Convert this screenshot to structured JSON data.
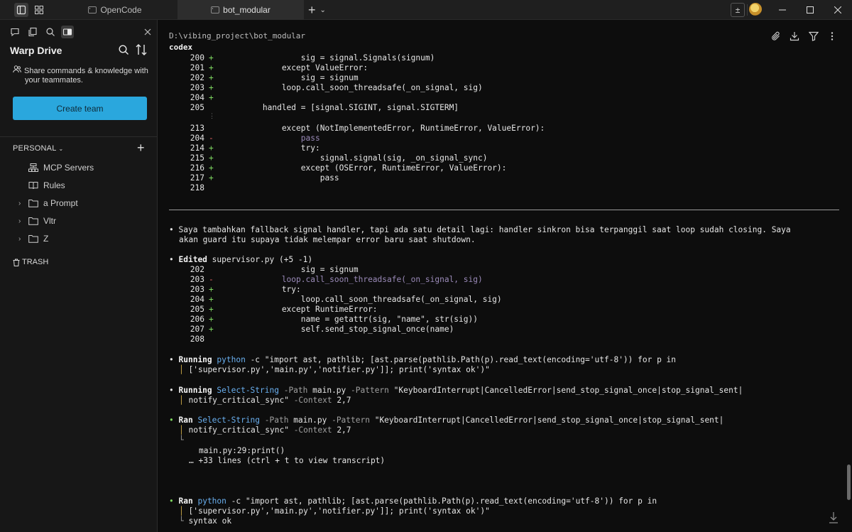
{
  "titlebar": {
    "tabs": [
      {
        "label": "OpenCode",
        "active": false
      },
      {
        "label": "bot_modular",
        "active": true
      }
    ],
    "new_tab_label": "+",
    "share_label": "±"
  },
  "sidebar": {
    "title": "Warp Drive",
    "share_line1": "Share commands & knowledge with",
    "share_line2": "your teammates.",
    "create_team_label": "Create team",
    "personal_label": "PERSONAL",
    "items": [
      {
        "label": "MCP Servers",
        "icon": "mcp-servers-icon",
        "folder": false
      },
      {
        "label": "Rules",
        "icon": "book-icon",
        "folder": false
      },
      {
        "label": "a Prompt",
        "icon": "folder-icon",
        "folder": true
      },
      {
        "label": "Vltr",
        "icon": "folder-icon",
        "folder": true
      },
      {
        "label": "Z",
        "icon": "folder-icon",
        "folder": true
      }
    ],
    "trash_label": "TRASH"
  },
  "main": {
    "path": "D:\\vibing_project\\bot_modular",
    "session": "codex",
    "diff1": [
      {
        "num": "200",
        "mk": "+",
        "code": "                sig = signal.Signals(signum)"
      },
      {
        "num": "201",
        "mk": "+",
        "code": "            except ValueError:"
      },
      {
        "num": "202",
        "mk": "+",
        "code": "                sig = signum"
      },
      {
        "num": "203",
        "mk": "+",
        "code": "            loop.call_soon_threadsafe(_on_signal, sig)"
      },
      {
        "num": "204",
        "mk": "+",
        "code": ""
      },
      {
        "num": "205",
        "mk": "",
        "code": "        handled = [signal.SIGINT, signal.SIGTERM]"
      },
      {
        "num": "213",
        "mk": "",
        "code": "            except (NotImplementedError, RuntimeError, ValueError):"
      },
      {
        "num": "204",
        "mk": "-",
        "code": "                pass"
      },
      {
        "num": "214",
        "mk": "+",
        "code": "                try:"
      },
      {
        "num": "215",
        "mk": "+",
        "code": "                    signal.signal(sig, _on_signal_sync)"
      },
      {
        "num": "216",
        "mk": "+",
        "code": "                except (OSError, RuntimeError, ValueError):"
      },
      {
        "num": "217",
        "mk": "+",
        "code": "                    pass"
      },
      {
        "num": "218",
        "mk": "",
        "code": ""
      }
    ],
    "message_line1": "Saya tambahkan fallback signal handler, tapi ada satu detail lagi: handler sinkron bisa terpanggil saat loop sudah closing. Saya",
    "message_line2": "akan guard itu supaya tidak melempar error baru saat shutdown.",
    "edited_label": "Edited",
    "edited_file": "supervisor.py",
    "edited_stats": "(+5 -1)",
    "diff2": [
      {
        "num": "202",
        "mk": "",
        "code": "                sig = signum"
      },
      {
        "num": "203",
        "mk": "-",
        "code": "            loop.call_soon_threadsafe(_on_signal, sig)"
      },
      {
        "num": "203",
        "mk": "+",
        "code": "            try:"
      },
      {
        "num": "204",
        "mk": "+",
        "code": "                loop.call_soon_threadsafe(_on_signal, sig)"
      },
      {
        "num": "205",
        "mk": "+",
        "code": "            except RuntimeError:"
      },
      {
        "num": "206",
        "mk": "+",
        "code": "                name = getattr(sig, \"name\", str(sig))"
      },
      {
        "num": "207",
        "mk": "+",
        "code": "                self.send_stop_signal_once(name)"
      },
      {
        "num": "208",
        "mk": "",
        "code": ""
      }
    ],
    "run1": {
      "label": "Running",
      "cmd": "python",
      "args": " -c \"import ast, pathlib; [ast.parse(pathlib.Path(p).read_text(encoding='utf-8')) for p in",
      "cont": "['supervisor.py','main.py','notifier.py']]; print('syntax ok')\""
    },
    "run2": {
      "label": "Running",
      "cmd": "Select-String",
      "flag1": " -Path",
      "arg1": " main.py",
      "flag2": " -Pattern",
      "arg2": " \"KeyboardInterrupt|CancelledError|send_stop_signal_once|stop_signal_sent|",
      "cont": "notify_critical_sync\"",
      "flag3": " -Context",
      "arg3": " 2,7"
    },
    "ran1": {
      "label": "Ran",
      "cmd": "Select-String",
      "flag1": " -Path",
      "arg1": " main.py",
      "flag2": " -Pattern",
      "arg2": " \"KeyboardInterrupt|CancelledError|send_stop_signal_once|stop_signal_sent|",
      "cont": "notify_critical_sync\"",
      "flag3": " -Context",
      "arg3": " 2,7",
      "out1": "main.py:29:print()",
      "out2": "… +33 lines (ctrl + t to view transcript)"
    },
    "ran2": {
      "label": "Ran",
      "cmd": "python",
      "args": " -c \"import ast, pathlib; [ast.parse(pathlib.Path(p).read_text(encoding='utf-8')) for p in",
      "cont": "['supervisor.py','main.py','notifier.py']]; print('syntax ok')\"",
      "out": "syntax ok"
    }
  },
  "colors": {
    "accent": "#2aa7dd",
    "added": "#7ed860",
    "removed": "#e36363",
    "keyword": "#c38bf2",
    "function": "#73a5f0"
  }
}
